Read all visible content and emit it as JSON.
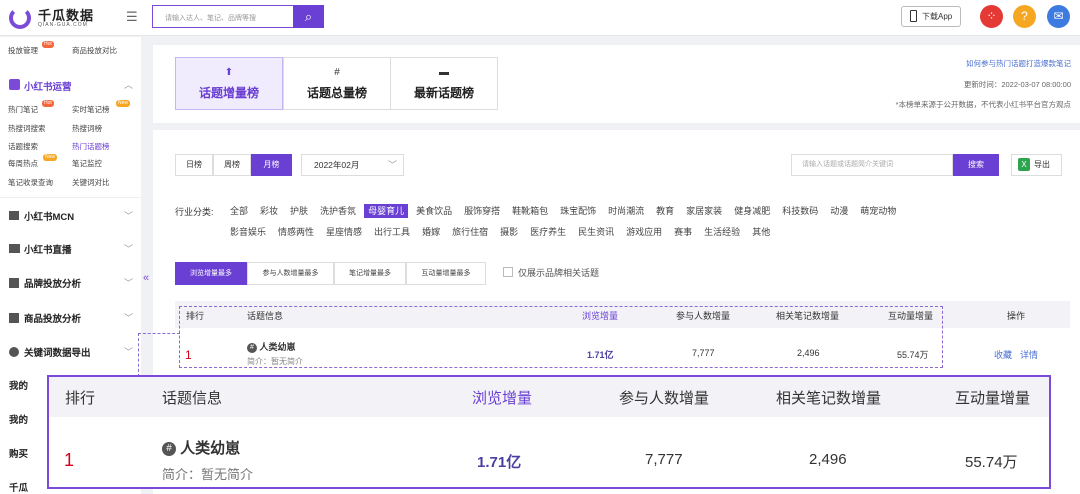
{
  "header": {
    "logo_text": "千瓜数据",
    "logo_sub": "QIAN-GUA.COM",
    "search_placeholder": "请输入达人、笔记、品牌等搜",
    "download_label": "下载App"
  },
  "sidebar": {
    "top_links": [
      "投放管理",
      "商品投放对比"
    ],
    "top_badge": "Hot",
    "section_redbook": "小红书运营",
    "redbook_items": [
      {
        "label": "热门笔记",
        "badge": "Hot"
      },
      {
        "label": "实时笔记榜",
        "badge": "New"
      },
      {
        "label": "热搜词搜索",
        "badge": ""
      },
      {
        "label": "热搜词榜",
        "badge": ""
      },
      {
        "label": "话题搜索",
        "badge": ""
      },
      {
        "label": "热门话题榜",
        "badge": ""
      },
      {
        "label": "每周热点",
        "badge": "New"
      },
      {
        "label": "笔记监控",
        "badge": ""
      },
      {
        "label": "笔记收录查询",
        "badge": ""
      },
      {
        "label": "关键词对比",
        "badge": ""
      }
    ],
    "sections": [
      "小红书MCN",
      "小红书直播",
      "品牌投放分析",
      "商品投放分析",
      "关键词数据导出",
      "我的",
      "我的",
      "购买",
      "千瓜"
    ]
  },
  "rank_tabs": [
    "话题增量榜",
    "话题总量榜",
    "最新话题榜"
  ],
  "info": {
    "help_link": "如何参与热门话题打造爆款笔记",
    "updated": "更新时间：2022-03-07 08:00:00",
    "note": "*本榜单来源于公开数据，不代表小红书平台官方观点"
  },
  "period_tabs": [
    "日榜",
    "周榜",
    "月榜"
  ],
  "month": "2022年02月",
  "keyword_placeholder": "请输入话题或话题简介关键词",
  "search_label": "搜索",
  "export_label": "导出",
  "category_label": "行业分类:",
  "categories_row1": [
    "全部",
    "彩妆",
    "护肤",
    "洗护香氛",
    "母婴育儿",
    "美食饮品",
    "服饰穿搭",
    "鞋靴箱包",
    "珠宝配饰",
    "时尚潮流",
    "教育",
    "家居家装",
    "健身减肥",
    "科技数码",
    "动漫",
    "萌宠动物"
  ],
  "categories_row2": [
    "影音娱乐",
    "情感两性",
    "星座情感",
    "出行工具",
    "婚嫁",
    "旅行住宿",
    "摄影",
    "医疗养生",
    "民生资讯",
    "游戏应用",
    "赛事",
    "生活经验",
    "其他"
  ],
  "active_category": "母婴育儿",
  "sort_tabs": [
    "浏览增量最多",
    "参与人数增量最多",
    "笔记增量最多",
    "互动量增量最多"
  ],
  "brand_checkbox": "仅展示品牌相关话题",
  "table": {
    "headers": [
      "排行",
      "话题信息",
      "浏览增量",
      "参与人数增量",
      "相关笔记数增量",
      "互动量增量",
      "操作"
    ],
    "row": {
      "rank": "1",
      "topic": "人类幼崽",
      "intro": "简介：暂无简介",
      "views": "1.71亿",
      "participants": "7,777",
      "notes": "2,496",
      "interactions": "55.74万",
      "actions": [
        "收藏",
        "详情"
      ]
    }
  },
  "colors": {
    "accent": "#6a3fd3",
    "rank_red": "#d0021b",
    "hot": "#f5663a",
    "new": "#f5a623"
  }
}
